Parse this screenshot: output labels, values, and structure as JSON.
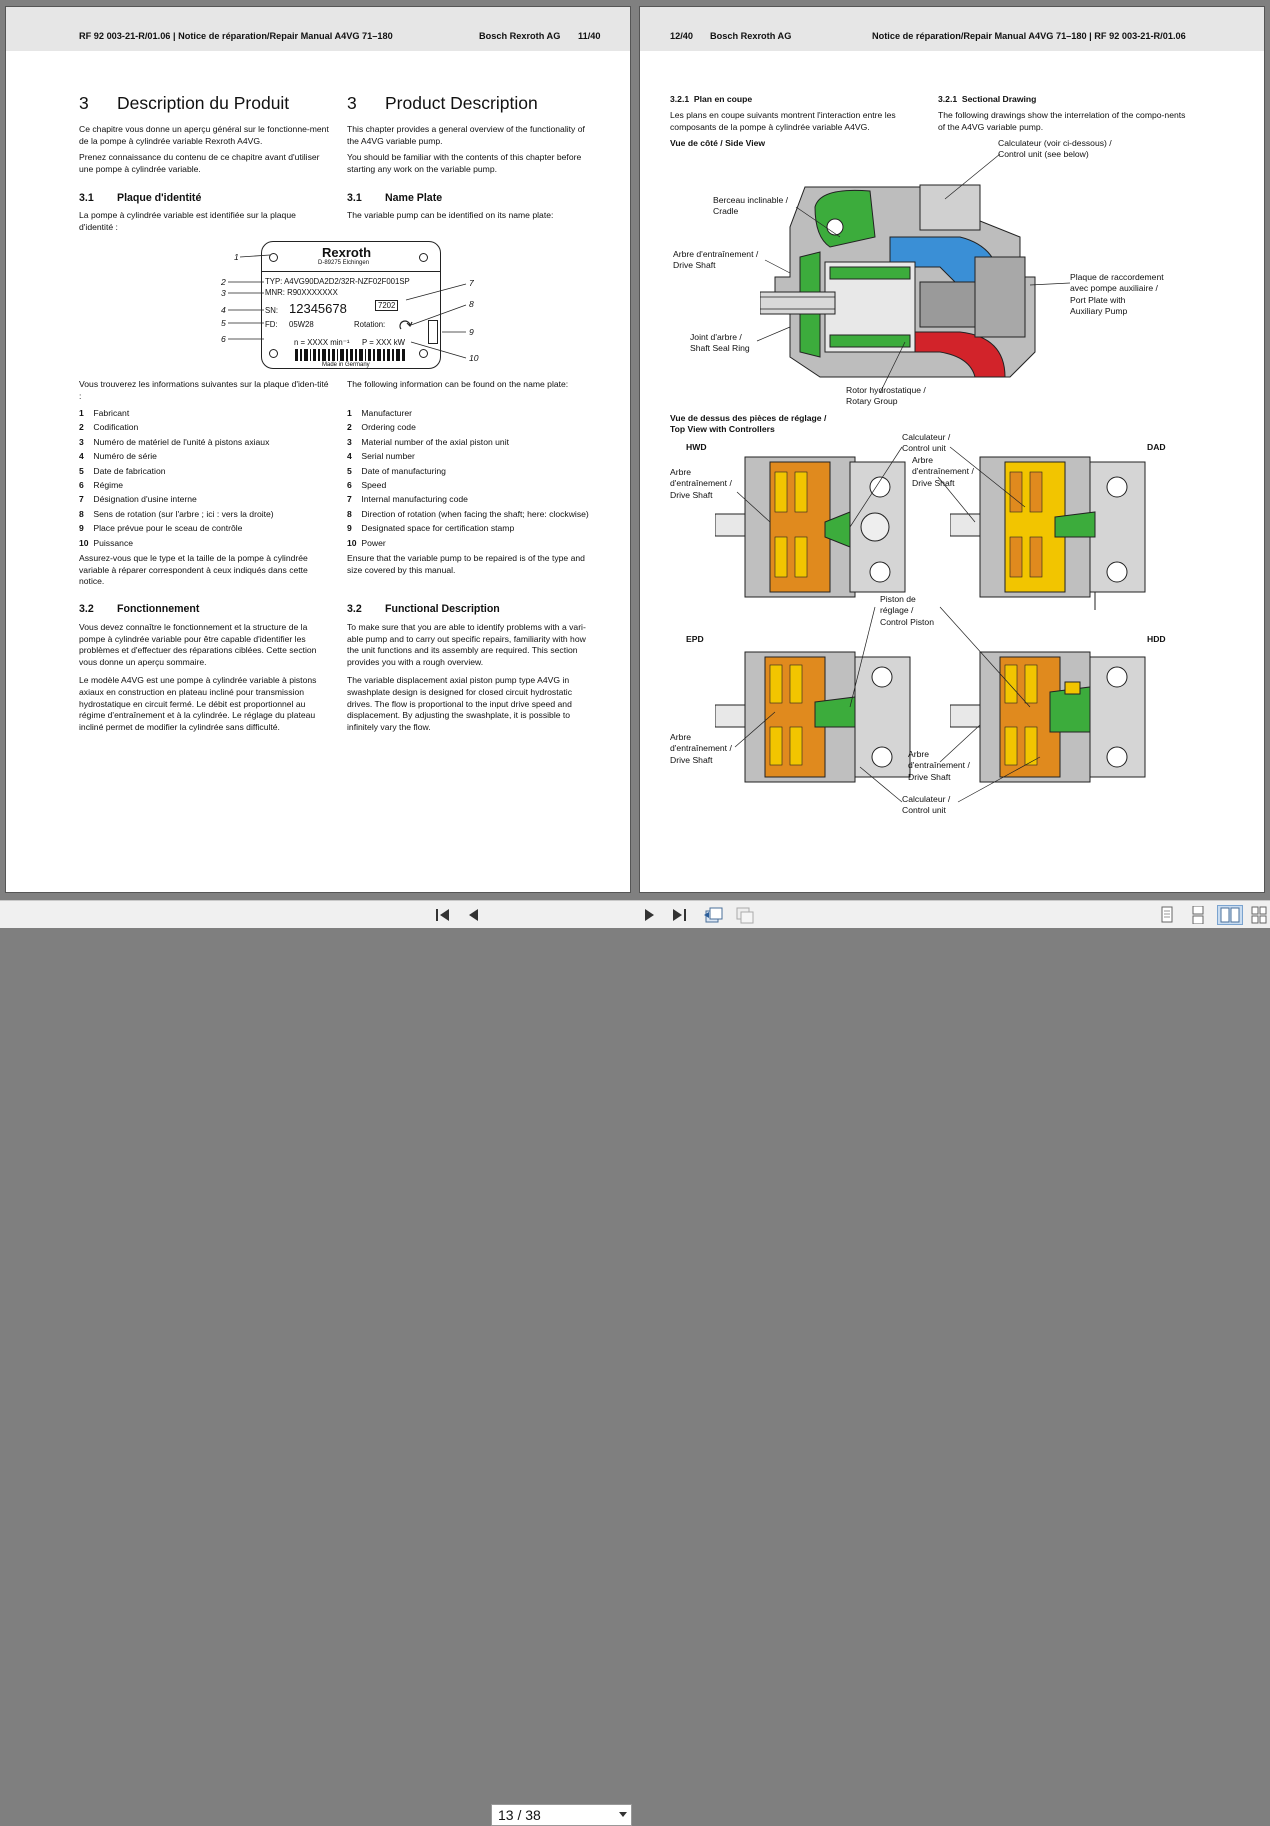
{
  "left_page": {
    "header": {
      "doc_ref": "RF 92 003-21-R/01.06 | Notice de réparation/Repair Manual A4VG 71–180",
      "company": "Bosch Rexroth AG",
      "page": "11/40"
    },
    "fr": {
      "chapter_num": "3",
      "chapter_title": "Description du Produit",
      "intro1": "Ce chapitre vous donne un aperçu général sur le fonctionne-ment de la pompe à cylindrée variable Rexroth A4VG.",
      "intro2": "Prenez connaissance du contenu de ce chapitre avant d'utiliser une pompe à cylindrée variable.",
      "s31_num": "3.1",
      "s31_title": "Plaque d'identité",
      "s31_text": "La pompe à cylindrée variable est identifiée sur la plaque d'identité :",
      "info_text": "Vous trouverez les informations suivantes sur la plaque d'iden-tité :",
      "items": [
        {
          "n": "1",
          "t": "Fabricant"
        },
        {
          "n": "2",
          "t": "Codification"
        },
        {
          "n": "3",
          "t": "Numéro de matériel de l'unité à pistons axiaux"
        },
        {
          "n": "4",
          "t": "Numéro de série"
        },
        {
          "n": "5",
          "t": "Date de fabrication"
        },
        {
          "n": "6",
          "t": "Régime"
        },
        {
          "n": "7",
          "t": "Désignation d'usine interne"
        },
        {
          "n": "8",
          "t": "Sens de rotation (sur l'arbre ; ici : vers la droite)"
        },
        {
          "n": "9",
          "t": "Place prévue pour le sceau de contrôle"
        },
        {
          "n": "10",
          "t": "Puissance"
        }
      ],
      "ensure": "Assurez-vous que le type et la taille de la pompe à cylindrée variable à réparer correspondent à ceux indiqués dans cette notice.",
      "s32_num": "3.2",
      "s32_title": "Fonctionnement",
      "s32_p1": "Vous devez connaître le fonctionnement et la structure de la pompe à cylindrée variable pour être capable d'identifier les problèmes et d'effectuer des réparations ciblées. Cette section vous donne un aperçu sommaire.",
      "s32_p2": "Le modèle A4VG est une pompe à cylindrée variable à pistons axiaux en construction en plateau incliné pour transmission hydrostatique en circuit fermé. Le débit est proportionnel au régime d'entraînement et à la cylindrée. Le réglage du plateau incliné permet de modifier la cylindrée sans difficulté."
    },
    "en": {
      "chapter_num": "3",
      "chapter_title": "Product Description",
      "intro1": "This chapter provides a general overview of the functionality of the A4VG variable pump.",
      "intro2": "You should be familiar with the contents of this chapter before starting any work on the variable pump.",
      "s31_num": "3.1",
      "s31_title": "Name Plate",
      "s31_text": "The variable pump can be identified on its name plate:",
      "info_text": "The following information can be found on the name plate:",
      "items": [
        {
          "n": "1",
          "t": "Manufacturer"
        },
        {
          "n": "2",
          "t": "Ordering code"
        },
        {
          "n": "3",
          "t": "Material number of the axial piston unit"
        },
        {
          "n": "4",
          "t": "Serial number"
        },
        {
          "n": "5",
          "t": "Date of manufacturing"
        },
        {
          "n": "6",
          "t": "Speed"
        },
        {
          "n": "7",
          "t": "Internal manufacturing code"
        },
        {
          "n": "8",
          "t": "Direction of rotation (when facing the shaft; here: clockwise)"
        },
        {
          "n": "9",
          "t": "Designated space for certification stamp"
        },
        {
          "n": "10",
          "t": "Power"
        }
      ],
      "ensure": "Ensure that the variable pump to be repaired is of the type and size covered by this manual.",
      "s32_num": "3.2",
      "s32_title": "Functional Description",
      "s32_p1": "To make sure that you are able to identify problems with a vari-able pump and to carry out specific repairs, familiarity with how the unit functions and its assembly are required. This section provides you with a rough overview.",
      "s32_p2": "The variable displacement axial piston pump type A4VG in swashplate design is designed for closed circuit hydrostatic drives. The flow is proportional to the input drive speed and displacement. By adjusting the swashplate, it is possible to infinitely vary the flow."
    },
    "nameplate": {
      "brand": "Rexroth",
      "location": "D-89275 Elchingen",
      "typ": "TYP:  A4VG90DA2D2/32R-NZF02F001SP",
      "mnr": "MNR:  R90XXXXXXX",
      "sn_label": "SN:",
      "sn_value": "12345678",
      "code": "7202",
      "fd_label": "FD:",
      "fd_value": "05W28",
      "rotation": "Rotation:",
      "speed": "n = XXXX min⁻¹",
      "power": "P = XXX kW",
      "made": "Made in Germany",
      "callouts": [
        "1",
        "2",
        "3",
        "4",
        "5",
        "6",
        "7",
        "8",
        "9",
        "10"
      ]
    }
  },
  "right_page": {
    "header": {
      "page": "12/40",
      "company": "Bosch Rexroth AG",
      "doc_ref": "Notice de réparation/Repair Manual A4VG 71–180 | RF 92 003-21-R/01.06"
    },
    "fr_sub_num": "3.2.1",
    "fr_sub_title": "Plan en coupe",
    "fr_sub_text": "Les plans en coupe suivants montrent l'interaction entre les composants de la pompe à cylindrée variable A4VG.",
    "en_sub_num": "3.2.1",
    "en_sub_title": "Sectional Drawing",
    "en_sub_text": "The following drawings show the interrelation of the compo-nents of the A4VG variable pump.",
    "side_view": "Vue de côté / Side View",
    "side_labels": {
      "control": "Calculateur (voir ci-dessous) /\nControl unit (see below)",
      "cradle": "Berceau inclinable /\nCradle",
      "drive": "Arbre d'entraînement /\nDrive Shaft",
      "port": "Plaque de raccordement\navec pompe auxiliaire /\nPort Plate with\nAuxiliary Pump",
      "seal": "Joint d'arbre /\nShaft Seal Ring",
      "rotor": "Rotor hydrostatique /\nRotary Group"
    },
    "top_view": "Vue de dessus des pièces de réglage /\nTop View with Controllers",
    "ctrl_names": {
      "hwd": "HWD",
      "dad": "DAD",
      "epd": "EPD",
      "hdd": "HDD"
    },
    "top_labels": {
      "control_top": "Calculateur /\nControl unit",
      "drive_left": "Arbre\nd'entraînement /\nDrive Shaft",
      "drive_mid": "Arbre\nd'entraînement /\nDrive Shaft",
      "piston": "Piston de\nréglage /\nControl Piston",
      "drive_bl": "Arbre\nd'entraînement /\nDrive Shaft",
      "drive_br": "Arbre\nd'entraînement /\nDrive Shaft",
      "control_bottom": "Calculateur /\nControl unit"
    }
  },
  "toolbar": {
    "page_value": "13 / 38"
  },
  "colors": {
    "green": "#3cac3c",
    "blue": "#3a8fd6",
    "red": "#d2232a",
    "yellow": "#f2c500",
    "orange": "#e08a1e",
    "gray": "#bfbfbf"
  }
}
